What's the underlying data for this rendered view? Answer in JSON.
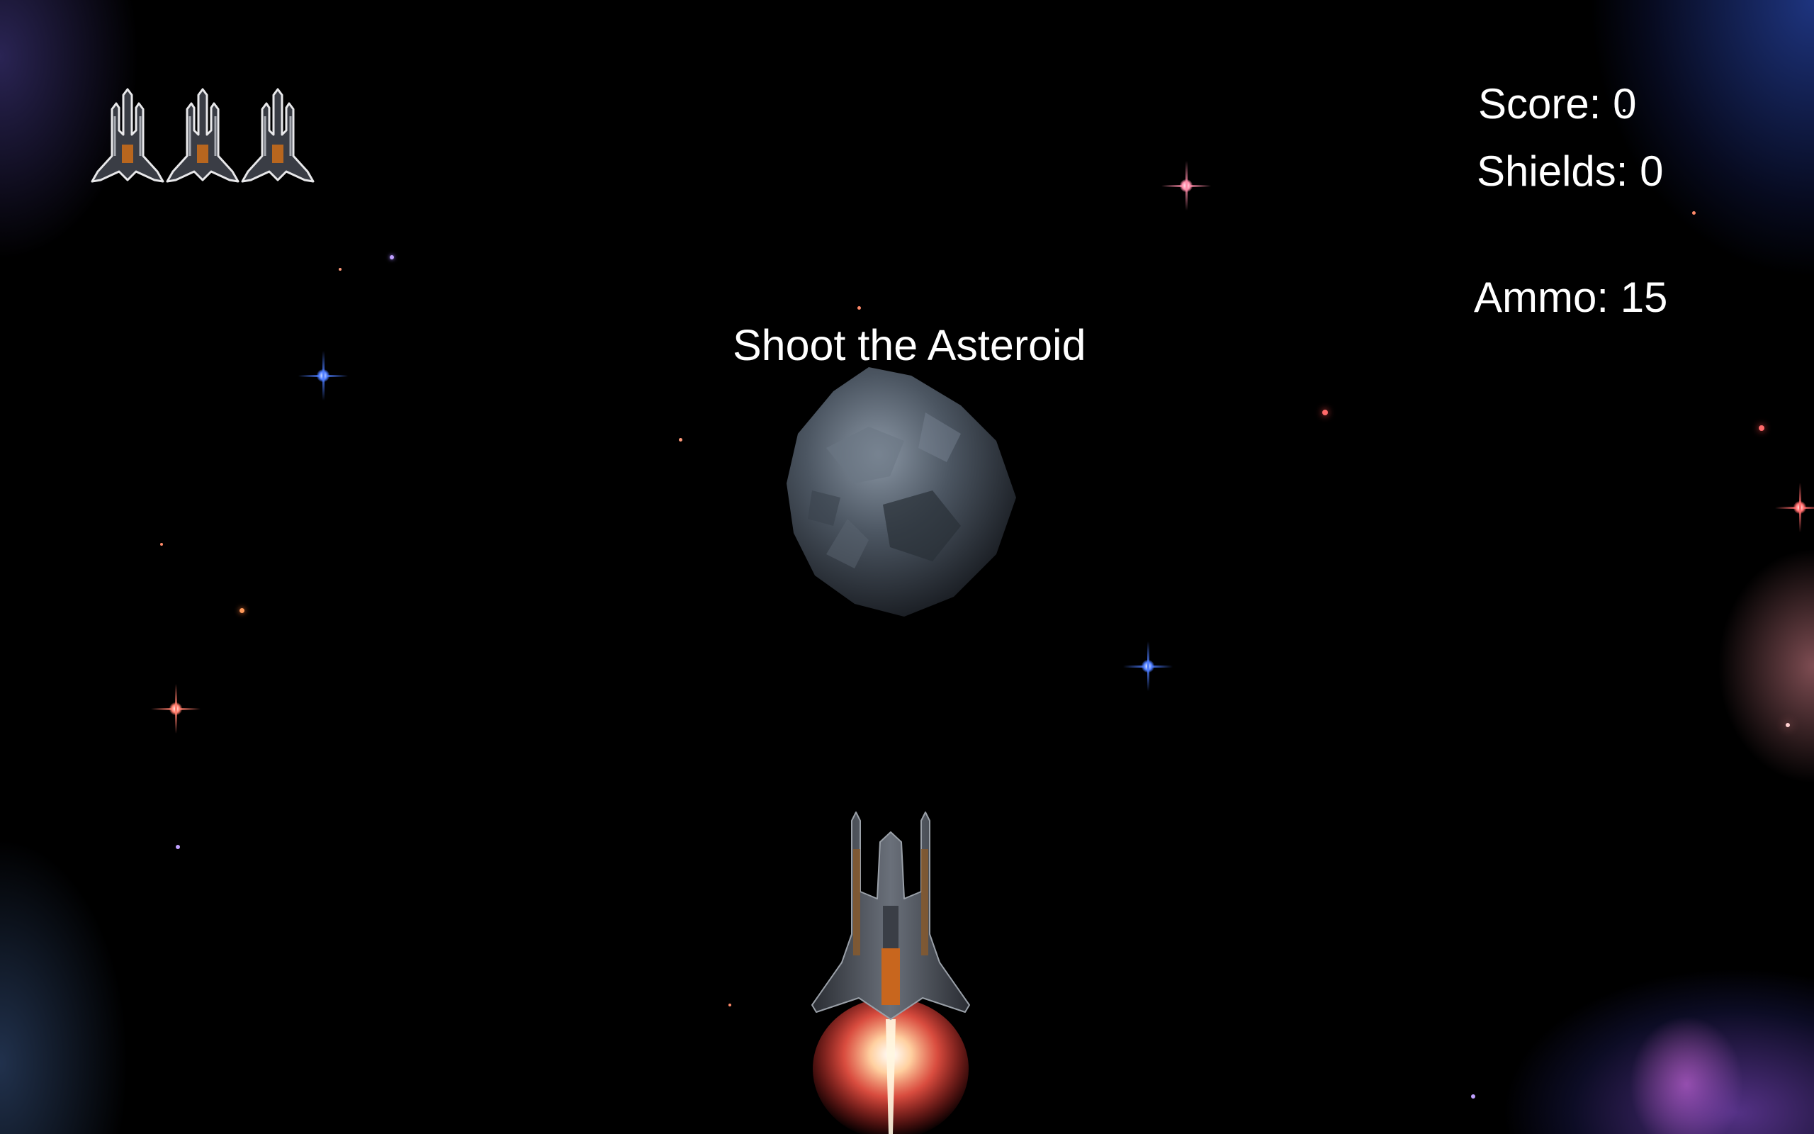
{
  "hud": {
    "score_text": "Score: 0",
    "shields_text": "Shields: 0",
    "ammo_text": "Ammo: 15",
    "objective_text": "Shoot the Asteroid"
  },
  "lives": {
    "count": 3,
    "icon": "ship-icon"
  },
  "entities": {
    "asteroid_icon": "asteroid",
    "player_icon": "player-ship"
  },
  "colors": {
    "text": "#ffffff",
    "background": "#000000",
    "engine_glow": "#ff5a4a",
    "ship_accent": "#c8661e"
  }
}
